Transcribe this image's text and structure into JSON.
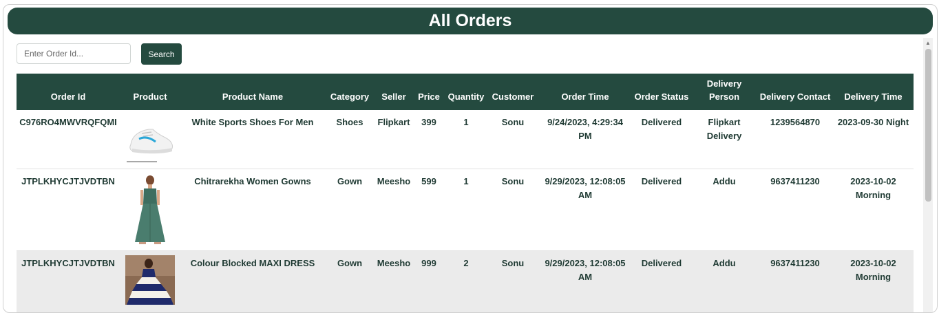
{
  "page": {
    "title": "All Orders"
  },
  "search": {
    "placeholder": "Enter Order Id...",
    "value": "",
    "button_label": "Search"
  },
  "table": {
    "headers": [
      "Order Id",
      "Product",
      "Product Name",
      "Category",
      "Seller",
      "Price",
      "Quantity",
      "Customer",
      "Order Time",
      "Order Status",
      "Delivery Person",
      "Delivery Contact",
      "Delivery Time"
    ],
    "rows": [
      {
        "order_id": "C976RO4MWVRQFQMI",
        "product_image": "white-sneaker-image",
        "product_name": "White Sports Shoes For Men",
        "category": "Shoes",
        "seller": "Flipkart",
        "price": "399",
        "quantity": "1",
        "customer": "Sonu",
        "order_time": "9/24/2023, 4:29:34 PM",
        "order_status": "Delivered",
        "delivery_person": "Flipkart Delivery",
        "delivery_contact": "1239564870",
        "delivery_time": "2023-09-30 Night"
      },
      {
        "order_id": "JTPLKHYCJTJVDTBN",
        "product_image": "green-gown-image",
        "product_name": "Chitrarekha Women Gowns",
        "category": "Gown",
        "seller": "Meesho",
        "price": "599",
        "quantity": "1",
        "customer": "Sonu",
        "order_time": "9/29/2023, 12:08:05 AM",
        "order_status": "Delivered",
        "delivery_person": "Addu",
        "delivery_contact": "9637411230",
        "delivery_time": "2023-10-02 Morning"
      },
      {
        "order_id": "JTPLKHYCJTJVDTBN",
        "product_image": "maxi-dress-image",
        "product_name": "Colour Blocked MAXI DRESS",
        "category": "Gown",
        "seller": "Meesho",
        "price": "999",
        "quantity": "2",
        "customer": "Sonu",
        "order_time": "9/29/2023, 12:08:05 AM",
        "order_status": "Delivered",
        "delivery_person": "Addu",
        "delivery_contact": "9637411230",
        "delivery_time": "2023-10-02 Morning"
      }
    ]
  },
  "colors": {
    "primary": "#244a3f",
    "row_alt": "#ebebeb",
    "text": "#1f3a33"
  }
}
